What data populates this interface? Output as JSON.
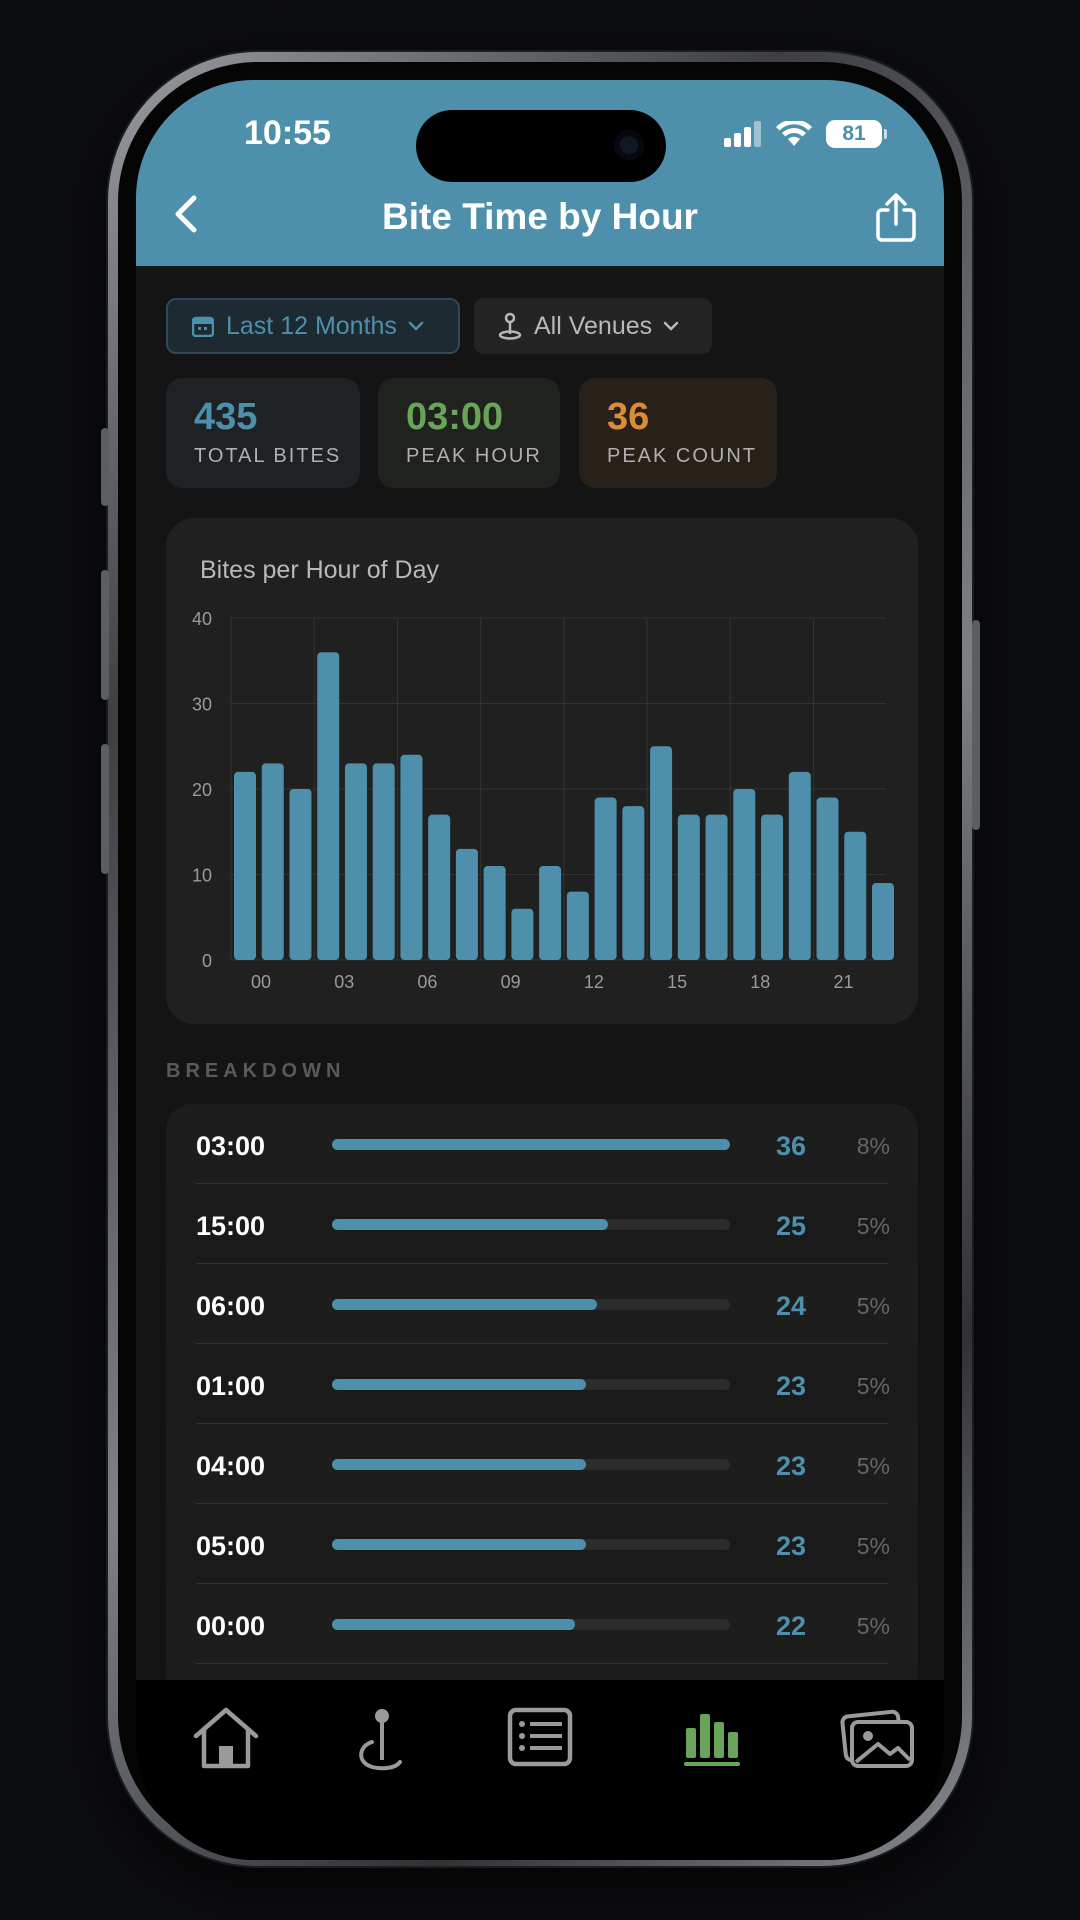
{
  "status": {
    "time": "10:55",
    "battery": "81"
  },
  "header": {
    "title": "Bite Time by Hour"
  },
  "filters": {
    "date": "Last 12 Months",
    "venue": "All Venues"
  },
  "stats": [
    {
      "value": "435",
      "label": "TOTAL BITES"
    },
    {
      "value": "03:00",
      "label": "PEAK HOUR"
    },
    {
      "value": "36",
      "label": "PEAK COUNT"
    }
  ],
  "chart_data": {
    "type": "bar",
    "title": "Bites per Hour of Day",
    "categories": [
      "00",
      "01",
      "02",
      "03",
      "04",
      "05",
      "06",
      "07",
      "08",
      "09",
      "10",
      "11",
      "12",
      "13",
      "14",
      "15",
      "16",
      "17",
      "18",
      "19",
      "20",
      "21",
      "22",
      "23"
    ],
    "values": [
      22,
      23,
      20,
      36,
      23,
      23,
      24,
      17,
      13,
      11,
      6,
      11,
      8,
      19,
      18,
      25,
      17,
      17,
      20,
      17,
      22,
      19,
      15,
      9
    ],
    "xtick_labels": [
      "00",
      "03",
      "06",
      "09",
      "12",
      "15",
      "18",
      "21"
    ],
    "yticks": [
      "0",
      "10",
      "20",
      "30",
      "40"
    ],
    "ylim": [
      0,
      40
    ],
    "color": "#4e90ac",
    "grid": true
  },
  "breakdown": {
    "label": "BREAKDOWN",
    "rows": [
      {
        "hour": "03:00",
        "count": "36",
        "pct": "8%",
        "fraction": 1.0
      },
      {
        "hour": "15:00",
        "count": "25",
        "pct": "5%",
        "fraction": 0.694
      },
      {
        "hour": "06:00",
        "count": "24",
        "pct": "5%",
        "fraction": 0.667
      },
      {
        "hour": "01:00",
        "count": "23",
        "pct": "5%",
        "fraction": 0.639
      },
      {
        "hour": "04:00",
        "count": "23",
        "pct": "5%",
        "fraction": 0.639
      },
      {
        "hour": "05:00",
        "count": "23",
        "pct": "5%",
        "fraction": 0.639
      },
      {
        "hour": "00:00",
        "count": "22",
        "pct": "5%",
        "fraction": 0.611
      },
      {
        "hour": "",
        "count": "",
        "pct": "",
        "fraction": 0
      }
    ]
  },
  "tabs": [
    {
      "icon": "home-icon",
      "active": false
    },
    {
      "icon": "fishing-spot-icon",
      "active": false
    },
    {
      "icon": "log-list-icon",
      "active": false
    },
    {
      "icon": "stats-chart-icon",
      "active": true
    },
    {
      "icon": "gallery-icon",
      "active": false
    }
  ],
  "colors": {
    "accent": "#4e90ac",
    "green": "#6aa35a",
    "orange": "#d98d3a",
    "tab_active": "#6aa35a"
  }
}
